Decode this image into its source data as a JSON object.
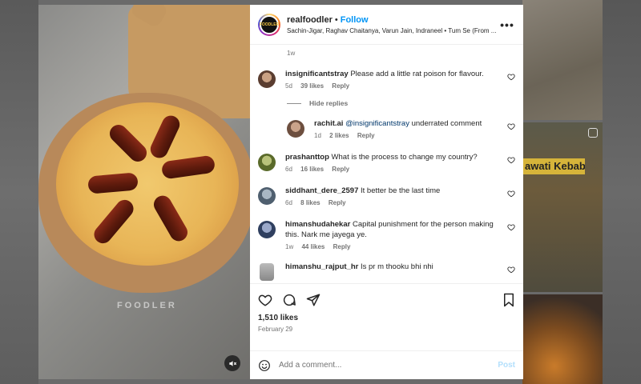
{
  "background": {
    "overlay_label": "awati Kebab"
  },
  "media": {
    "watermark": "FOODLER",
    "mute_icon": "speaker-muted-icon"
  },
  "header": {
    "username": "realfoodler",
    "separator": "•",
    "follow_label": "Follow",
    "audio_line": "Sachin-Jigar, Raghav Chaitanya, Varun Jain, Indraneel • Tum Se (From ...",
    "avatar_text": "FOODLER",
    "more_icon": "more-horizontal-icon"
  },
  "caption": {
    "time": "1w"
  },
  "comments": [
    {
      "user": "insignificantstray",
      "text": "Please add a little rat poison for flavour.",
      "time": "5d",
      "likes": "39 likes",
      "reply": "Reply",
      "avatar_color": "#7a5a4a"
    },
    {
      "user": "rachit.ai",
      "mention": "@insignificantstray",
      "text": " underrated comment",
      "time": "1d",
      "likes": "2 likes",
      "reply": "Reply",
      "avatar_color": "#8b6a55"
    },
    {
      "user": "prashanttop",
      "text": "What is the process to change my country?",
      "time": "6d",
      "likes": "16 likes",
      "reply": "Reply",
      "avatar_color": "#7f8a4a"
    },
    {
      "user": "siddhant_dere_2597",
      "text": "It better be the last time",
      "time": "6d",
      "likes": "8 likes",
      "reply": "Reply",
      "avatar_color": "#6f7f8f"
    },
    {
      "user": "himanshudahekar",
      "text": "Capital punishment for the person making this. Nark me jayega ye.",
      "time": "1w",
      "likes": "44 likes",
      "reply": "Reply",
      "avatar_color": "#4a5a7a"
    },
    {
      "user": "himanshu_rajput_hr",
      "text": "Is pr m thooku bhi nhi",
      "avatar_color": "#9a9a9a"
    }
  ],
  "hide_replies": "Hide replies",
  "actions": {
    "likes": "1,510 likes",
    "date": "February 29"
  },
  "add_comment": {
    "placeholder": "Add a comment...",
    "post_label": "Post"
  },
  "colors": {
    "accent": "#0095f6",
    "text": "#262626",
    "muted": "#737373"
  }
}
